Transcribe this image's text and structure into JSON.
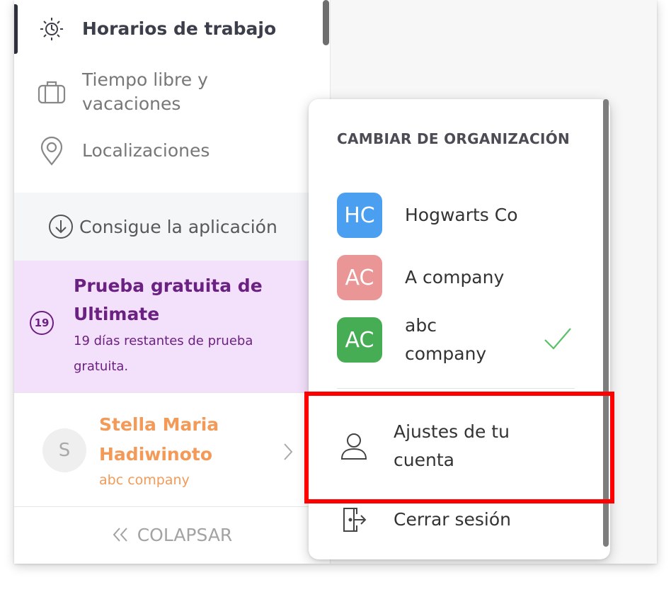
{
  "sidebar": {
    "nav": [
      {
        "label": "Horarios de trabajo",
        "icon": "sun-clock-icon",
        "active": true
      },
      {
        "label": "Tiempo libre y vacaciones",
        "icon": "suitcase-icon",
        "active": false
      },
      {
        "label": "Localizaciones",
        "icon": "location-pin-icon",
        "active": false
      }
    ],
    "get_app": {
      "label": "Consigue la aplicación",
      "icon": "download-circle-icon"
    },
    "trial": {
      "days": "19",
      "title": "Prueba gratuita de Ultimate",
      "subtitle": "19 días restantes de prueba gratuita."
    },
    "user": {
      "initial": "S",
      "name": "Stella Maria Hadiwinoto",
      "company": "abc company"
    },
    "collapse_label": "COLAPSAR"
  },
  "dropdown": {
    "section_title": "CAMBIAR DE ORGANIZACIÓN",
    "organizations": [
      {
        "initials": "HC",
        "name": "Hogwarts Co",
        "color": "#4b9ff0",
        "selected": false
      },
      {
        "initials": "AC",
        "name": "A company",
        "color": "#eb9696",
        "selected": false
      },
      {
        "initials": "AC",
        "name": "abc company",
        "color": "#47ad55",
        "selected": true
      }
    ],
    "account_settings": "Ajustes de tu cuenta",
    "logout": "Cerrar sesión"
  },
  "colors": {
    "trial_bg": "#f3e0fb",
    "trial_text": "#6b2182",
    "user_accent": "#f39a59",
    "check": "#5cbf6a",
    "highlight": "#ff0000"
  }
}
